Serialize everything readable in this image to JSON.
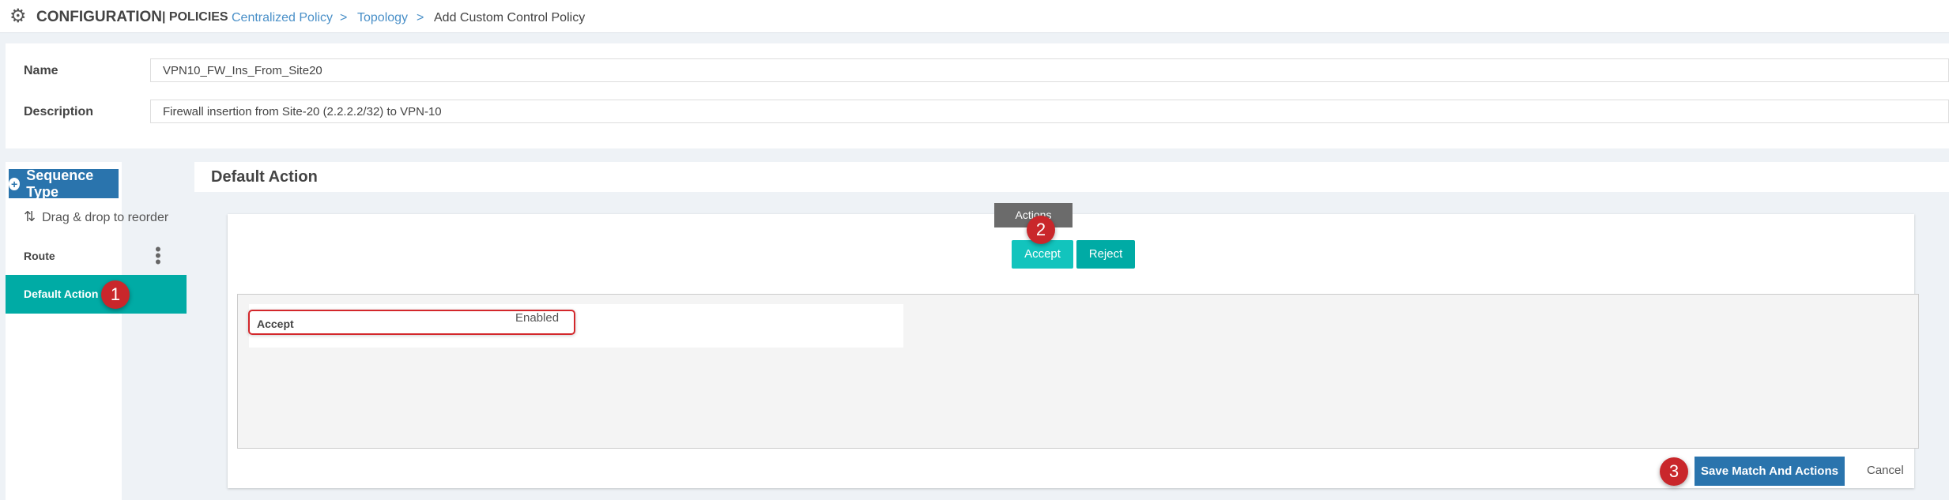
{
  "header": {
    "gear_icon": "gear-icon",
    "title": "CONFIGURATION",
    "section": "| POLICIES",
    "breadcrumb": [
      {
        "label": "Centralized Policy"
      },
      {
        "label": "Topology"
      },
      {
        "label": "Add Custom Control Policy"
      }
    ],
    "separator": ">"
  },
  "form": {
    "name_label": "Name",
    "name_value": "VPN10_FW_Ins_From_Site20",
    "description_label": "Description",
    "description_value": "Firewall insertion from Site-20 (2.2.2.2/32) to VPN-10"
  },
  "sidebar": {
    "sequence_type": "Sequence Type",
    "drag_hint": "Drag & drop to reorder",
    "items": [
      {
        "label": "Route"
      },
      {
        "label": "Default Action",
        "selected": true
      }
    ]
  },
  "main": {
    "title": "Default Action",
    "actions_tab": "Actions",
    "accept": "Accept",
    "reject": "Reject",
    "row": {
      "label": "Accept",
      "status": "Enabled"
    },
    "save": "Save Match And Actions",
    "cancel": "Cancel"
  },
  "annotations": [
    "1",
    "2",
    "3"
  ],
  "colors": {
    "primary": "#2a74ad",
    "teal": "#00aba5",
    "accept": "#12c4bd",
    "badge": "#c9272b",
    "link": "#4a90c8"
  }
}
